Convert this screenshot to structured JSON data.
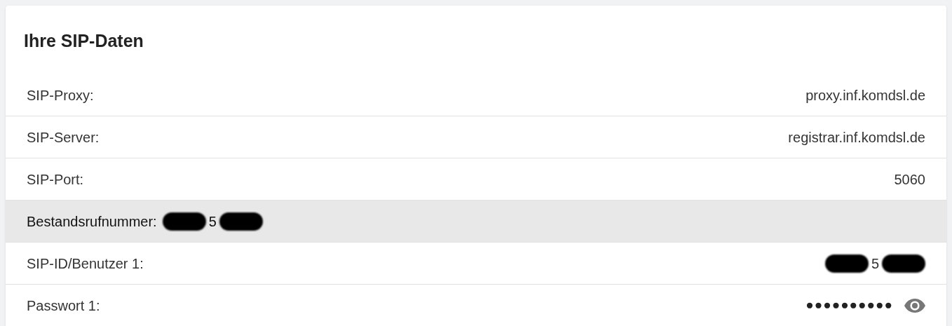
{
  "card": {
    "title": "Ihre SIP-Daten"
  },
  "rows": [
    {
      "kind": "plain",
      "label": "SIP-Proxy:",
      "value": "proxy.inf.komdsl.de"
    },
    {
      "kind": "plain",
      "label": "SIP-Server:",
      "value": "registrar.inf.komdsl.de"
    },
    {
      "kind": "plain",
      "label": "SIP-Port:",
      "value": "5060"
    },
    {
      "kind": "highlighted",
      "label": "Bestandsrufnummer:",
      "value": "5",
      "redacted": true
    },
    {
      "kind": "plain",
      "label": "SIP-ID/Benutzer 1:",
      "value": "5",
      "redacted": true
    },
    {
      "kind": "secret",
      "label": "Passwort 1:",
      "value": "●●●●●●●●●●"
    }
  ]
}
